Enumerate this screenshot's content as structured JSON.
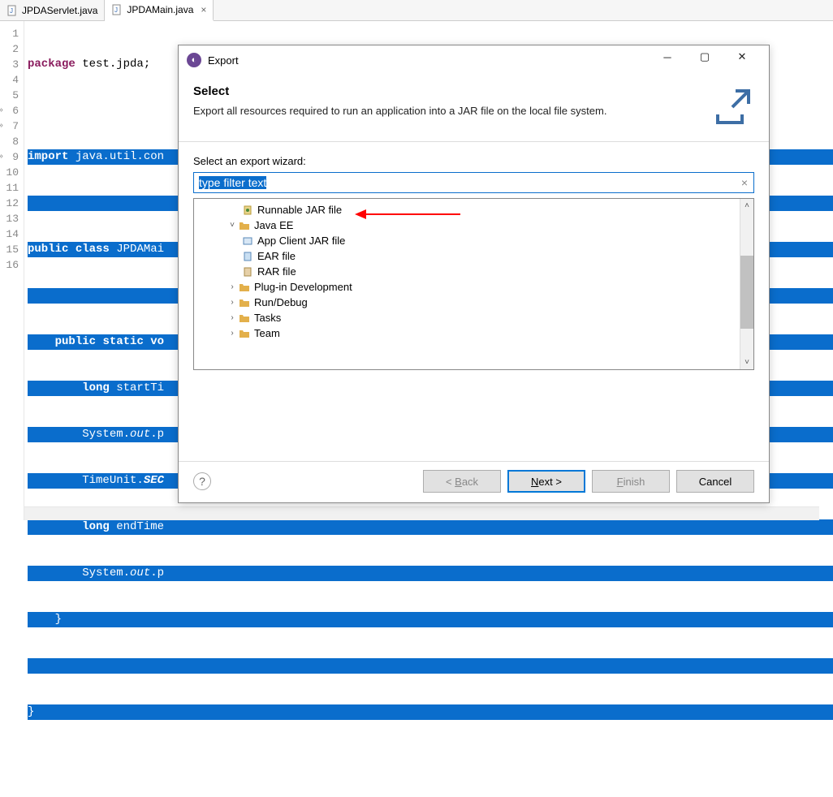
{
  "tabs": [
    {
      "label": "JPDAServlet.java",
      "active": false
    },
    {
      "label": "JPDAMain.java",
      "active": true
    }
  ],
  "code": {
    "lines": [
      "package test.jpda;",
      "",
      "import java.util.con",
      "",
      "public class JPDAMai",
      "",
      "    public static vo",
      "        long startTi",
      "        System.out.p",
      "        TimeUnit.SEC",
      "        long endTime",
      "        System.out.p",
      "    }",
      "",
      "}",
      ""
    ],
    "line_count": 16
  },
  "dialog": {
    "title": "Export",
    "heading": "Select",
    "description": "Export all resources required to run an application into a JAR file on the local file system.",
    "wizard_label": "Select an export wizard:",
    "filter_text": "type filter text",
    "tree": [
      {
        "label": "Runnable JAR file",
        "icon": "jar",
        "level": 2
      },
      {
        "label": "Java EE",
        "toggle": "expanded",
        "icon": "folder",
        "level": 1
      },
      {
        "label": "App Client JAR file",
        "icon": "app-client",
        "level": 2
      },
      {
        "label": "EAR file",
        "icon": "ear",
        "level": 2
      },
      {
        "label": "RAR file",
        "icon": "rar",
        "level": 2
      },
      {
        "label": "Plug-in Development",
        "toggle": "collapsed",
        "icon": "folder",
        "level": 1
      },
      {
        "label": "Run/Debug",
        "toggle": "collapsed",
        "icon": "folder",
        "level": 1
      },
      {
        "label": "Tasks",
        "toggle": "collapsed",
        "icon": "folder",
        "level": 1
      },
      {
        "label": "Team",
        "toggle": "collapsed",
        "icon": "folder",
        "level": 1
      }
    ],
    "buttons": {
      "back": "< Back",
      "next": "Next >",
      "finish": "Finish",
      "cancel": "Cancel"
    }
  }
}
